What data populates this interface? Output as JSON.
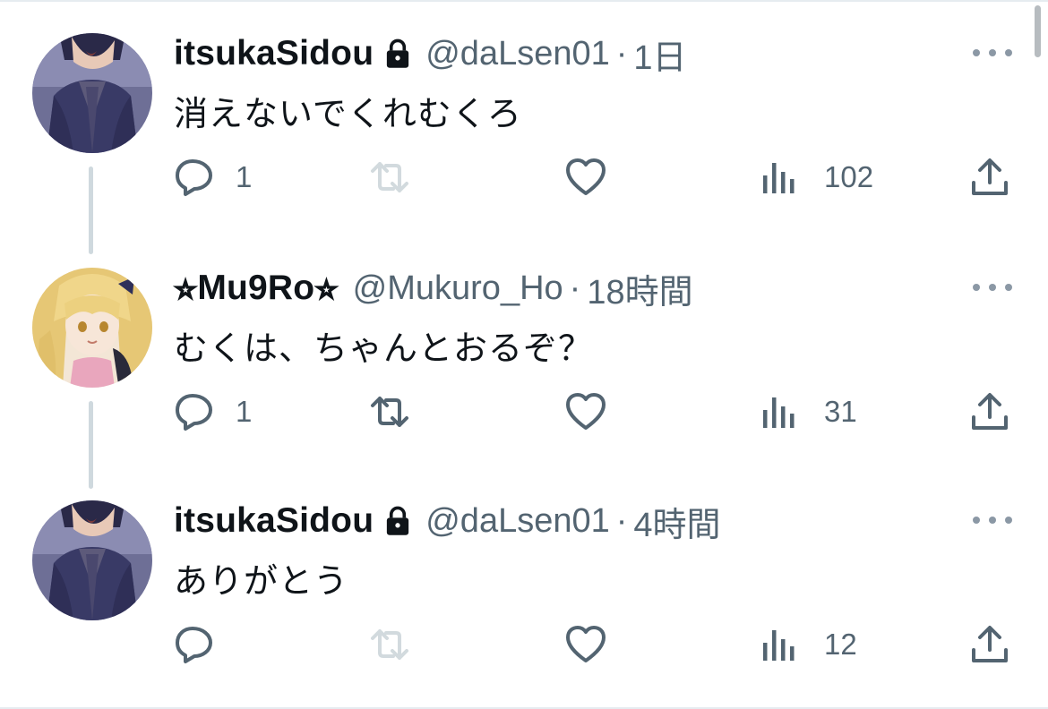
{
  "colors": {
    "text": "#0f1419",
    "muted": "#536471",
    "icon": "#536471",
    "icon_disabled": "#d2dade",
    "thread_line": "#cfd9de",
    "more_dots": "#8b98a5"
  },
  "tweets": [
    {
      "display_name": "itsukaSidou",
      "protected": true,
      "handle": "@daLsen01",
      "separator": "·",
      "time": "1日",
      "text": "消えないでくれむくろ",
      "avatar": "dark-haired-boy-avatar",
      "retweet_disabled": true,
      "reply_count": "1",
      "retweet_count": "",
      "like_count": "",
      "view_count": "102"
    },
    {
      "display_name": "⭐︎Mu9Ro⭐︎",
      "protected": false,
      "handle": "@Mukuro_Ho",
      "separator": "·",
      "time": "18時間",
      "text": "むくは、ちゃんとおるぞ？",
      "avatar": "blonde-girl-avatar",
      "retweet_disabled": false,
      "reply_count": "1",
      "retweet_count": "",
      "like_count": "",
      "view_count": "31"
    },
    {
      "display_name": "itsukaSidou",
      "protected": true,
      "handle": "@daLsen01",
      "separator": "·",
      "time": "4時間",
      "text": "ありがとう",
      "avatar": "dark-haired-boy-avatar",
      "retweet_disabled": true,
      "reply_count": "",
      "retweet_count": "",
      "like_count": "",
      "view_count": "12"
    }
  ]
}
